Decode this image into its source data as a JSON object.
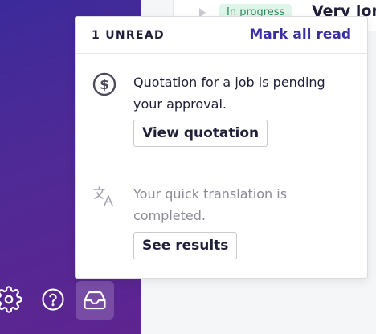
{
  "background_row": {
    "status_badge": "In progress",
    "title": "Very lon"
  },
  "notifications_popover": {
    "unread_label": "1 UNREAD",
    "mark_all_read": "Mark all read",
    "items": [
      {
        "icon": "dollar-circle-icon",
        "text": "Quotation for a job is pending your approval.",
        "action": "View quotation",
        "read": false
      },
      {
        "icon": "translate-icon",
        "text": "Your quick translation is completed.",
        "action": "See results",
        "read": true
      }
    ]
  },
  "bottom_bar": {
    "icons": [
      "gear-icon",
      "help-circle-icon",
      "inbox-icon"
    ]
  },
  "colors": {
    "sidebar_gradient_start": "#3c2a9a",
    "sidebar_gradient_end": "#5e2490",
    "accent": "#3a2ea6",
    "badge_bg": "#dff5ea",
    "badge_text": "#2b8a5b"
  }
}
